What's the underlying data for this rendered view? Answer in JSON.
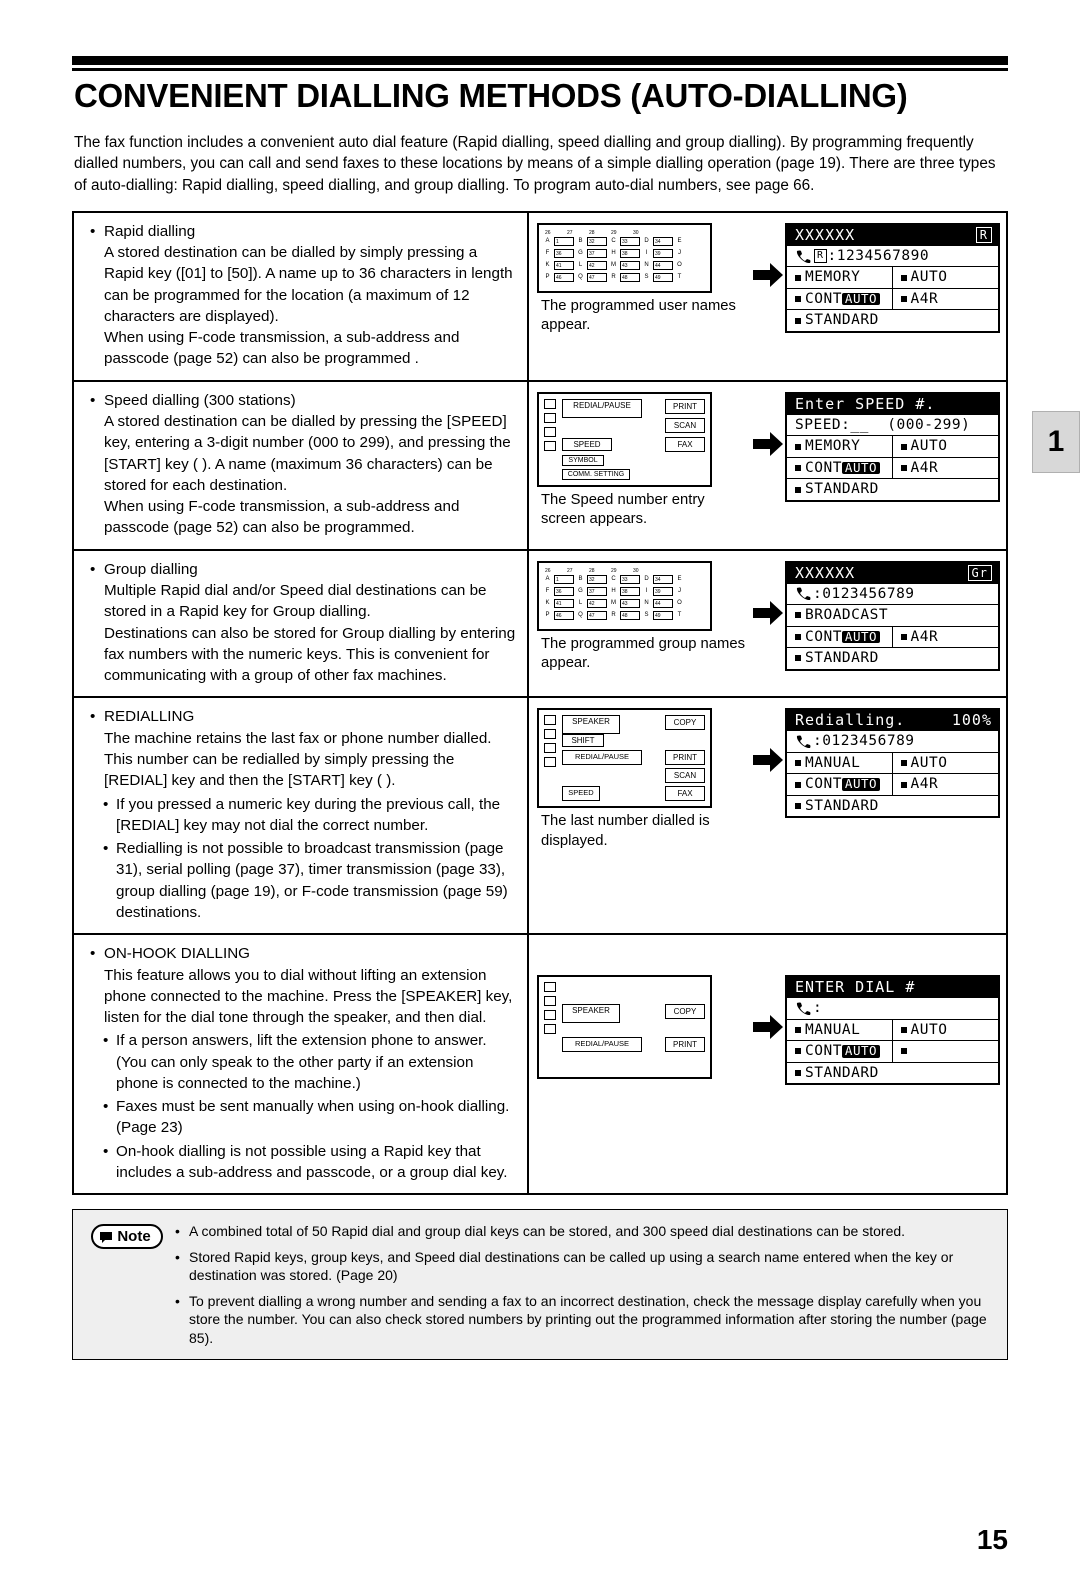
{
  "page": {
    "title": "CONVENIENT DIALLING METHODS (AUTO-DIALLING)",
    "intro": "The fax function includes a convenient auto dial feature (Rapid dialling, speed dialling and group dialling). By programming frequently dialled numbers, you can call and send faxes to these locations by means of a simple dialling operation (page 19). There are three types of auto-dialling: Rapid dialling, speed dialling, and group dialling. To program auto-dial numbers, see page 66.",
    "tab_number": "1",
    "folio": "15"
  },
  "sections": [
    {
      "heading": "Rapid dialling",
      "body": "A stored destination can be dialled by simply pressing a Rapid key ([01] to [50]). A name up to 36 characters in length can be programmed for the location (a maximum of 12 characters are displayed).\nWhen using F-code transmission, a sub-address and passcode (page 52) can also be programmed .",
      "caption": "The programmed user names appear.",
      "lcd": {
        "title": "XXXXXX",
        "title_right": "R",
        "line1": ":1234567890",
        "left1": "MEMORY",
        "right1": "AUTO",
        "left2": "CONT",
        "left2_badge": "AUTO",
        "right2": "A4R",
        "line3": "STANDARD"
      }
    },
    {
      "heading": "Speed dialling (300 stations)",
      "body": "A stored destination can be dialled by pressing the [SPEED] key, entering a 3-digit number (000 to 299), and pressing the [START] key (   ). A name (maximum 36 characters) can be stored for each destination.\nWhen using F-code transmission, a sub-address and passcode (page 52) can also be programmed.",
      "caption": "The Speed number entry screen appears.",
      "keys": [
        "REDIAL/PAUSE",
        "PRINT",
        "SCAN",
        "FAX",
        "SPEED",
        "SYMBOL",
        "COMM. SETTING"
      ],
      "lcd": {
        "title": "Enter SPEED #.",
        "title_right": "",
        "line1": "SPEED:__  (000-299)",
        "left1": "MEMORY",
        "right1": "AUTO",
        "left2": "CONT",
        "left2_badge": "AUTO",
        "right2": "A4R",
        "line3": "STANDARD"
      }
    },
    {
      "heading": "Group dialling",
      "body": "Multiple Rapid dial and/or Speed dial destinations can be stored in a Rapid key for Group dialling.\nDestinations can also be stored for Group dialling by entering fax numbers with the numeric keys. This is convenient for communicating with a group of other fax machines.",
      "caption": "The programmed group names appear.",
      "lcd": {
        "title": "XXXXXX",
        "title_right": "Gr",
        "line1": ":0123456789",
        "left1": "BROADCAST",
        "right1": "",
        "left2": "CONT",
        "left2_badge": "AUTO",
        "right2": "A4R",
        "line3": "STANDARD"
      }
    },
    {
      "heading": "REDIALLING",
      "body": "The machine retains the last fax or phone number dialled. This number can be redialled by simply pressing the [REDIAL] key and then the [START] key (   ).",
      "subbullets": [
        "If you pressed a numeric key during the previous call, the [REDIAL] key may not dial the correct number.",
        "Redialling is not possible to broadcast transmission (page 31), serial polling (page 37), timer transmission (page 33), group dialling (page 19), or F-code transmission (page 59) destinations."
      ],
      "caption": "The last number dialled is displayed.",
      "keys": [
        "SPEAKER",
        "COPY",
        "SHIFT",
        "REDIAL/PAUSE",
        "PRINT",
        "SCAN",
        "SPEED",
        "FAX"
      ],
      "lcd": {
        "title": "Redialling.",
        "title_right": "100%",
        "line1": ":0123456789",
        "left1": "MANUAL",
        "right1": "AUTO",
        "left2": "CONT",
        "left2_badge": "AUTO",
        "right2": "A4R",
        "line3": "STANDARD"
      }
    },
    {
      "heading": "ON-HOOK DIALLING",
      "body": "This feature allows you to dial without lifting an extension phone connected to the machine. Press the [SPEAKER] key, listen for the dial tone through the speaker, and then dial.",
      "subbullets": [
        "If a person answers, lift the extension phone to answer. (You can only speak to the other party if an extension phone is connected to the machine.)",
        "Faxes must be sent manually when using on-hook dialling. (Page 23)",
        "On-hook dialling is not possible using a Rapid key that includes a sub-address and passcode, or a group dial key."
      ],
      "caption": "",
      "keys": [
        "SPEAKER",
        "COPY",
        "REDIAL/PAUSE",
        "PRINT"
      ],
      "lcd": {
        "title": "ENTER DIAL #",
        "title_right": "",
        "line1": ":",
        "left1": "MANUAL",
        "right1": "AUTO",
        "left2": "CONT",
        "left2_badge": "AUTO",
        "right2": "",
        "line3": "STANDARD"
      }
    }
  ],
  "note": {
    "label": "Note",
    "items": [
      "A combined total of 50 Rapid dial and group dial keys can be stored, and 300 speed dial destinations can be stored.",
      "Stored Rapid keys, group keys, and Speed dial destinations can be called up using a search name entered when the key or destination was stored. (Page 20)",
      "To prevent dialling a wrong number and sending a fax to an incorrect destination, check the message display carefully when you store the number. You can also check stored numbers by printing out the programmed information after storing the number (page 85)."
    ]
  }
}
